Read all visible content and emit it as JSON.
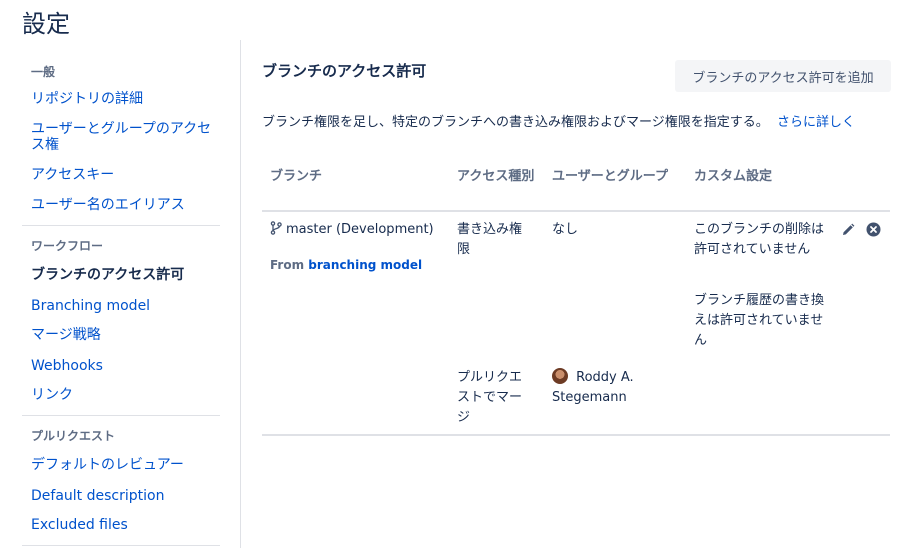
{
  "page": {
    "title": "設定"
  },
  "sidebar": {
    "groups": [
      {
        "heading": "一般",
        "items": [
          "リポジトリの詳細",
          "ユーザーとグループのアクセス権",
          "アクセスキー",
          "ユーザー名のエイリアス"
        ]
      },
      {
        "heading": "ワークフロー",
        "items": [
          "ブランチのアクセス許可",
          "Branching model",
          "マージ戦略",
          "Webhooks",
          "リンク"
        ]
      },
      {
        "heading": "プルリクエスト",
        "items": [
          "デフォルトのレビュアー",
          "Default description",
          "Excluded files"
        ]
      }
    ],
    "active_item": "ブランチのアクセス許可"
  },
  "main": {
    "title": "ブランチのアクセス許可",
    "add_button": "ブランチのアクセス許可を追加",
    "description": "ブランチ権限を足し、特定のブランチへの書き込み権限およびマージ権限を指定する。",
    "learn_more": "さらに詳しく",
    "columns": [
      "ブランチ",
      "アクセス種別",
      "ユーザーとグループ",
      "カスタム設定"
    ],
    "rows": [
      {
        "branch": "master (Development)",
        "source_prefix": "From",
        "source_link": "branching model",
        "access": [
          {
            "type": "書き込み権限",
            "users": "なし"
          },
          {
            "type": "プルリクエストでマージ",
            "users": "Roddy A. Stegemann"
          }
        ],
        "custom": [
          "このブランチの削除は許可されていません",
          "ブランチ履歴の書き換えは許可されていません"
        ]
      }
    ]
  },
  "icons": {
    "branch": "branch-icon",
    "edit": "pencil-icon",
    "delete": "close-circle-icon"
  },
  "colors": {
    "link": "#0052cc",
    "text": "#172b4d",
    "muted": "#5e6c84",
    "divider": "#dfe1e6",
    "button_bg": "#f4f5f7"
  }
}
